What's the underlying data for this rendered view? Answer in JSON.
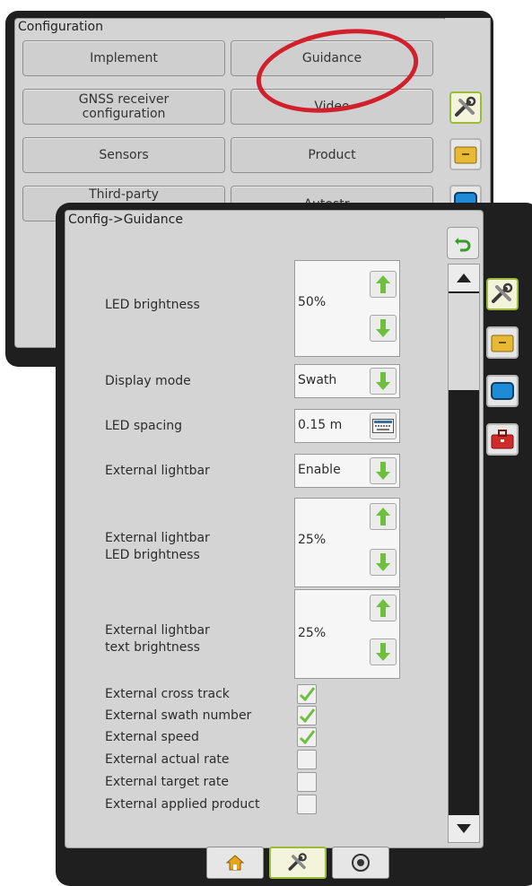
{
  "config_window": {
    "title": "Configuration",
    "buttons": {
      "implement": "Implement",
      "guidance": "Guidance",
      "gnss": "GNSS receiver\nconfiguration",
      "video": "Video",
      "sensors": "Sensors",
      "product": "Product",
      "third_party": "Third-party",
      "partial": "Autostr..."
    },
    "highlight_color": "#d11f2c"
  },
  "guidance_window": {
    "title": "Config->Guidance",
    "rows": {
      "led_brightness": {
        "label": "LED brightness",
        "value": "50%"
      },
      "display_mode": {
        "label": "Display mode",
        "value": "Swath"
      },
      "led_spacing": {
        "label": "LED spacing",
        "value": "0.15 m"
      },
      "external_lightbar": {
        "label": "External lightbar",
        "value": "Enable"
      },
      "ext_led_brightness": {
        "label": "External lightbar\nLED brightness",
        "value": "25%"
      },
      "ext_text_brightness": {
        "label": "External lightbar\ntext brightness",
        "value": "25%"
      }
    },
    "checkboxes": [
      {
        "label": "External cross track",
        "checked": true
      },
      {
        "label": "External swath number",
        "checked": true
      },
      {
        "label": "External speed",
        "checked": true
      },
      {
        "label": "External actual rate",
        "checked": false
      },
      {
        "label": "External target rate",
        "checked": false
      },
      {
        "label": "External applied product",
        "checked": false
      }
    ]
  },
  "colors": {
    "accent_green": "#6fbf3f",
    "active_border": "#9dbb3a",
    "toolbox_red": "#d12a2a",
    "screen_blue": "#1f8ad6",
    "folder_yellow": "#e8b934"
  },
  "icons": [
    "tools-icon",
    "folder-icon",
    "screen-icon",
    "toolbox-icon",
    "undo-icon",
    "home-icon",
    "camera-icon",
    "keyboard-icon",
    "arrow-up-icon",
    "arrow-down-icon",
    "checkmark-icon"
  ]
}
